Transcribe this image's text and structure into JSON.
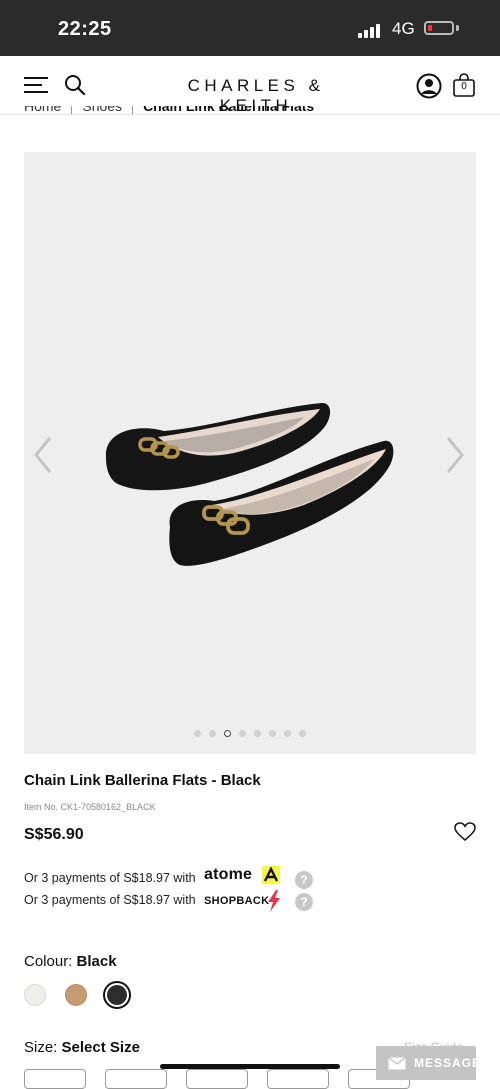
{
  "status_bar": {
    "time": "22:25",
    "network": "4G"
  },
  "header": {
    "brand": "CHARLES & KEITH",
    "bag_count": "0"
  },
  "breadcrumb": {
    "items": [
      "Home",
      "Shoes"
    ],
    "current": "Chain Link Ballerina Flats"
  },
  "gallery": {
    "dot_count": 8,
    "active_index": 2
  },
  "product": {
    "title": "Chain Link Ballerina Flats - Black",
    "item_no": "Item No. CK1-70580162_BLACK",
    "price": "S$56.90"
  },
  "payments": [
    {
      "text": "Or 3 payments of S$18.97 with",
      "provider": "atome"
    },
    {
      "text": "Or 3 payments of S$18.97 with",
      "provider": "SHOPBACK"
    }
  ],
  "colour": {
    "label": "Colour:",
    "selected": "Black",
    "swatches": [
      "#efefe9",
      "#c59b73",
      "#2d2d2d"
    ]
  },
  "size": {
    "label": "Size:",
    "selected": "Select Size",
    "guide": "Size Guide"
  },
  "message": {
    "label": "MESSAGE"
  },
  "colors": {
    "accent_yellow": "#f4f44a",
    "shopback_red": "#e8344a",
    "header_text": "#111111"
  }
}
